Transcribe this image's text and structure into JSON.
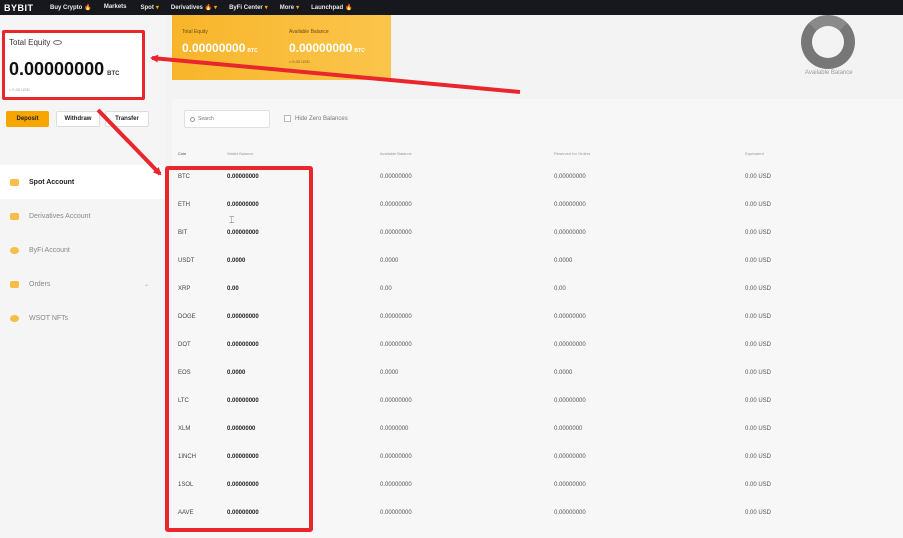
{
  "nav": {
    "logo": "BYBIT",
    "items": [
      {
        "label": "Buy Crypto",
        "fire": "🔥"
      },
      {
        "label": "Markets",
        "fire": ""
      },
      {
        "label": "Spot",
        "fire": "▾"
      },
      {
        "label": "Derivatives",
        "fire": "🔥 ▾"
      },
      {
        "label": "ByFi Center",
        "fire": "▾"
      },
      {
        "label": "More",
        "fire": "▾"
      },
      {
        "label": "Launchpad",
        "fire": "🔥"
      }
    ]
  },
  "equity": {
    "label": "Total Equity",
    "value": "0.00000000",
    "unit": "BTC",
    "usd": "≈ 0.00 USD"
  },
  "buttons": {
    "deposit": "Deposit",
    "withdraw": "Withdraw",
    "transfer": "Transfer"
  },
  "menu": [
    {
      "label": "Spot Account",
      "active": true,
      "chevron": ""
    },
    {
      "label": "Derivatives Account",
      "active": false,
      "chevron": ""
    },
    {
      "label": "ByFi Account",
      "active": false,
      "chevron": ""
    },
    {
      "label": "Orders",
      "active": false,
      "chevron": "⌄"
    },
    {
      "label": "WSOT NFTs",
      "active": false,
      "chevron": ""
    }
  ],
  "summary": {
    "total_equity_label": "Total Equity",
    "total_equity_value": "0.00000000",
    "total_equity_unit": "BTC",
    "total_equity_sub": "≈ 0.00 USD",
    "available_label": "Available Balance",
    "available_value": "0.00000000",
    "available_unit": "BTC",
    "available_sub": "≈ 0.00 USD",
    "chart_label": "Available Balance"
  },
  "table": {
    "search_placeholder": "Search",
    "hide_zero_label": "Hide Zero Balances",
    "headers": {
      "coin": "Coin",
      "wallet": "Wallet Balance",
      "available": "Available Balance",
      "reserved": "Reserved for Orders",
      "equivalent": "Equivalent"
    },
    "rows": [
      {
        "coin": "BTC",
        "wallet": "0.00000000",
        "available": "0.00000000",
        "reserved": "0.00000000",
        "equivalent": "0.00 USD"
      },
      {
        "coin": "ETH",
        "wallet": "0.00000000",
        "available": "0.00000000",
        "reserved": "0.00000000",
        "equivalent": "0.00 USD"
      },
      {
        "coin": "BIT",
        "wallet": "0.00000000",
        "available": "0.00000000",
        "reserved": "0.00000000",
        "equivalent": "0.00 USD"
      },
      {
        "coin": "USDT",
        "wallet": "0.0000",
        "available": "0.0000",
        "reserved": "0.0000",
        "equivalent": "0.00 USD"
      },
      {
        "coin": "XRP",
        "wallet": "0.00",
        "available": "0.00",
        "reserved": "0.00",
        "equivalent": "0.00 USD"
      },
      {
        "coin": "DOGE",
        "wallet": "0.00000000",
        "available": "0.00000000",
        "reserved": "0.00000000",
        "equivalent": "0.00 USD"
      },
      {
        "coin": "DOT",
        "wallet": "0.00000000",
        "available": "0.00000000",
        "reserved": "0.00000000",
        "equivalent": "0.00 USD"
      },
      {
        "coin": "EOS",
        "wallet": "0.0000",
        "available": "0.0000",
        "reserved": "0.0000",
        "equivalent": "0.00 USD"
      },
      {
        "coin": "LTC",
        "wallet": "0.00000000",
        "available": "0.00000000",
        "reserved": "0.00000000",
        "equivalent": "0.00 USD"
      },
      {
        "coin": "XLM",
        "wallet": "0.0000000",
        "available": "0.0000000",
        "reserved": "0.0000000",
        "equivalent": "0.00 USD"
      },
      {
        "coin": "1INCH",
        "wallet": "0.00000000",
        "available": "0.00000000",
        "reserved": "0.00000000",
        "equivalent": "0.00 USD"
      },
      {
        "coin": "1SOL",
        "wallet": "0.00000000",
        "available": "0.00000000",
        "reserved": "0.00000000",
        "equivalent": "0.00 USD"
      },
      {
        "coin": "AAVE",
        "wallet": "0.00000000",
        "available": "0.00000000",
        "reserved": "0.00000000",
        "equivalent": "0.00 USD"
      }
    ]
  },
  "colors": {
    "accent": "#f7a600",
    "annotation": "#e8262b",
    "nav_bg": "#17181e"
  }
}
